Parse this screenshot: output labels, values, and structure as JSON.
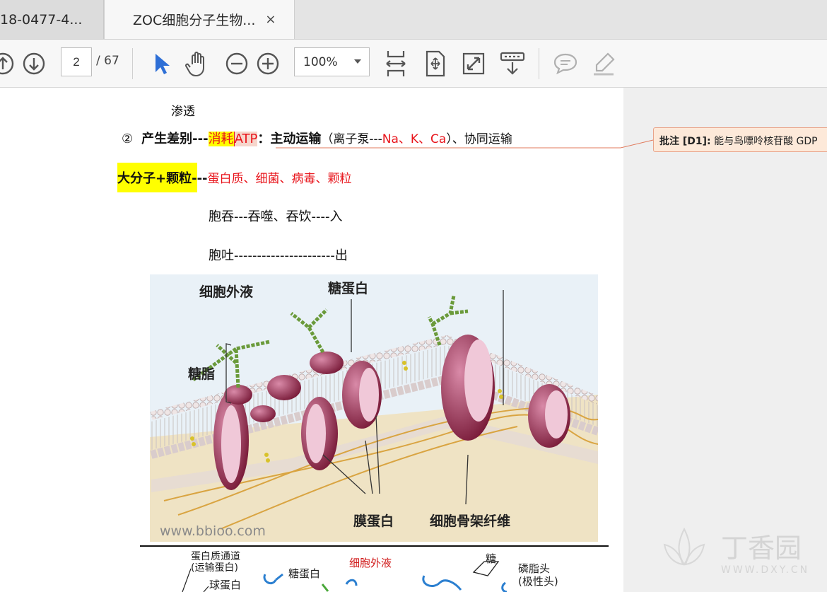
{
  "tabs": [
    {
      "label": "18-0477-4..."
    },
    {
      "label": "ZOC细胞分子生物...",
      "close": "×"
    }
  ],
  "toolbar": {
    "page_current": "2",
    "page_total": "/ 67",
    "zoom": "100%",
    "icons": [
      "arrow-up-icon",
      "arrow-down-icon",
      "select-pointer-icon",
      "hand-icon",
      "zoom-out-icon",
      "zoom-in-icon",
      "fit-width-icon",
      "rotate-icon",
      "fullscreen-icon",
      "download-icon",
      "comment-icon",
      "highlight-pen-icon"
    ]
  },
  "doc": {
    "line1": "渗透",
    "line2": {
      "num": "②",
      "a": "产生差别---",
      "b": "消耗",
      "c": "ATP",
      "d": "：主动运输",
      "e": "（离子泵---",
      "f": "Na、K、Ca",
      "g": "）、协同运输"
    },
    "line3": {
      "a": "大分子+颗粒-",
      "b": "--",
      "c": "蛋白质、细菌、病毒、颗粒"
    },
    "line4": "胞吞---吞噬、吞饮----入",
    "line5": "胞吐----------------------出"
  },
  "comment": {
    "label": "批注 [D1]:",
    "text": " 能与鸟嘌呤核苷酸 GDP"
  },
  "figure": {
    "labels": {
      "extracellular": "细胞外液",
      "glycoprotein": "糖蛋白",
      "glycolipid": "糖脂",
      "membrane_protein": "膜蛋白",
      "cytoskeleton": "细胞骨架纤维"
    },
    "watermark": "www.bbioo.com"
  },
  "figure2": {
    "channel": "蛋白质通道",
    "channel2": "(运输蛋白)",
    "globular": "球蛋白",
    "glycoprotein": "糖蛋白",
    "extracellular": "细胞外液",
    "sugar": "糖",
    "head": "磷脂头",
    "head2": "(极性头)"
  },
  "brand": {
    "name": "丁香园",
    "url": "WWW.DXY.CN"
  },
  "colors": {
    "red": "#e8141b",
    "highlight": "#ffff00",
    "accent": "#2e6fd6"
  }
}
